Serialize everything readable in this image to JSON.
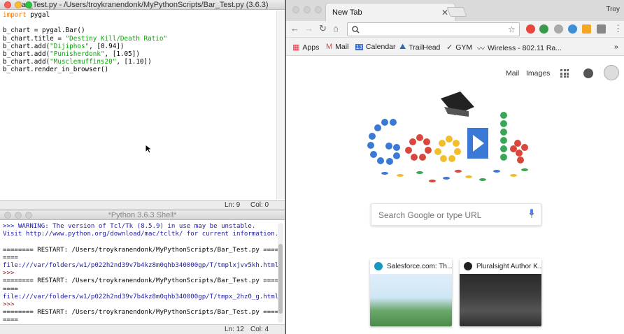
{
  "editor": {
    "title": "Bar_Test.py - /Users/troykranendonk/MyPythonScripts/Bar_Test.py (3.6.3)",
    "code": {
      "l1_kw": "import",
      "l1_rest": " pygal",
      "l3": "b_chart = pygal.Bar()",
      "l4_pre": "b_chart.title = ",
      "l4_str": "\"Destiny Kill/Death Ratio\"",
      "l5_pre": "b_chart.add(",
      "l5_str": "\"Dijiphos\"",
      "l5_post": ", [0.94])",
      "l6_pre": "b_chart.add(",
      "l6_str": "\"Punisherdonk\"",
      "l6_post": ", [1.05])",
      "l7_pre": "b_chart.add(",
      "l7_str": "\"Musclemuffins20\"",
      "l7_post": ", [1.10])",
      "l8": "b_chart.render_in_browser()"
    },
    "status": {
      "line": "Ln: 9",
      "col": "Col: 0"
    }
  },
  "shell": {
    "title": "*Python 3.6.3 Shell*",
    "warning1": ">>> WARNING: The version of Tcl/Tk (8.5.9) in use may be unstable.",
    "warning2": "Visit http://www.python.org/download/mac/tcltk/ for current information.",
    "restart1": "======== RESTART: /Users/troykranendonk/MyPythonScripts/Bar_Test.py =====",
    "restart_cont": "====",
    "file1": "file:///var/folders/w1/p022h2nd39v7b4kz8m0qhb340000gp/T/tmplxjvv5kh.html",
    "prompt": ">>>",
    "restart2": "======== RESTART: /Users/troykranendonk/MyPythonScripts/Bar_Test.py =====",
    "file2": "file:///var/folders/w1/p022h2nd39v7b4kz8m0qhb340000gp/T/tmpx_2hz0_g.html",
    "restart3": "======== RESTART: /Users/troykranendonk/MyPythonScripts/Bar_Test.py =====",
    "status": {
      "line": "Ln: 12",
      "col": "Col: 4"
    }
  },
  "chrome": {
    "tab_title": "New Tab",
    "tab_close": "✕",
    "user": "Troy",
    "bookmarks": [
      {
        "label": "Apps"
      },
      {
        "label": "Mail"
      },
      {
        "label": "Calendar"
      },
      {
        "label": "TrailHead"
      },
      {
        "label": "GYM"
      },
      {
        "label": "Wireless - 802.11 Ra..."
      }
    ],
    "bookmarks_more": "»",
    "top_links": {
      "mail": "Mail",
      "images": "Images"
    },
    "search_placeholder": "Search Google or type URL",
    "tiles": [
      {
        "title": "Salesforce.com: Th..."
      },
      {
        "title": "Pluralsight Author K..."
      }
    ]
  }
}
